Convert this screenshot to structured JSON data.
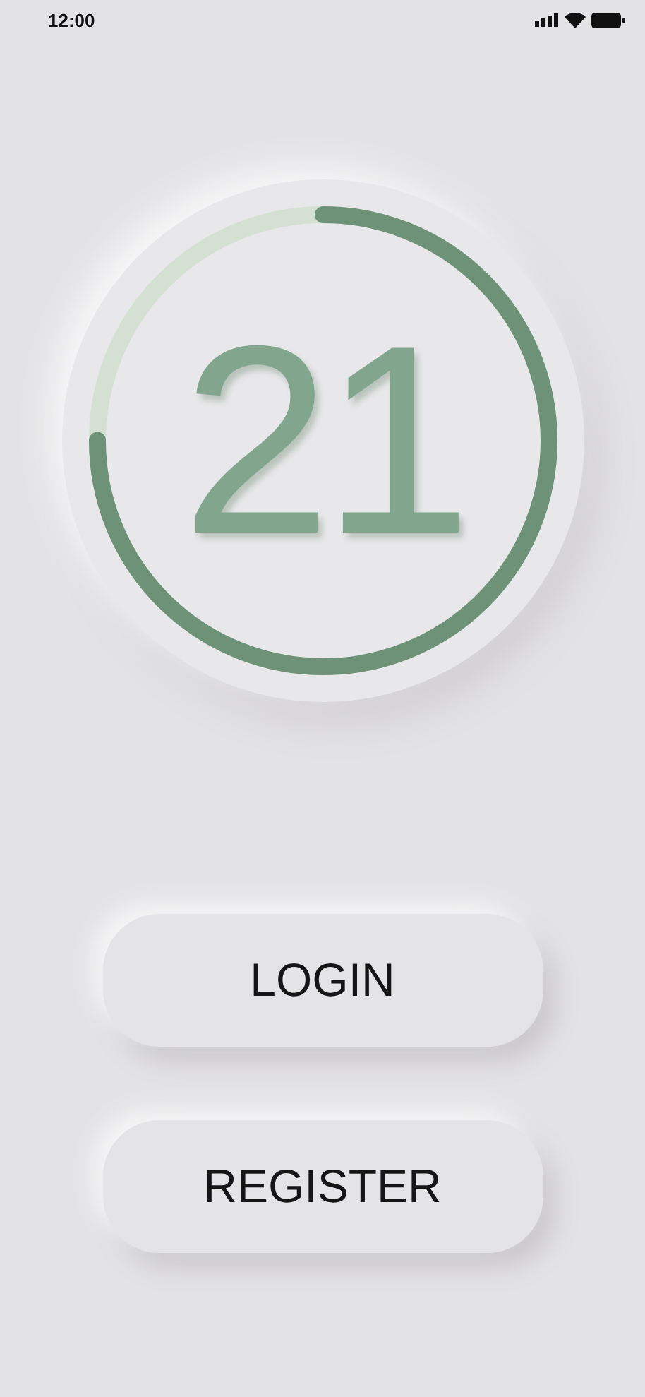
{
  "status_bar": {
    "time": "12:00"
  },
  "timer": {
    "value": "21",
    "level": 0.75
  },
  "buttons": [
    {
      "label": "LOGIN"
    },
    {
      "label": "REGISTER"
    }
  ]
}
